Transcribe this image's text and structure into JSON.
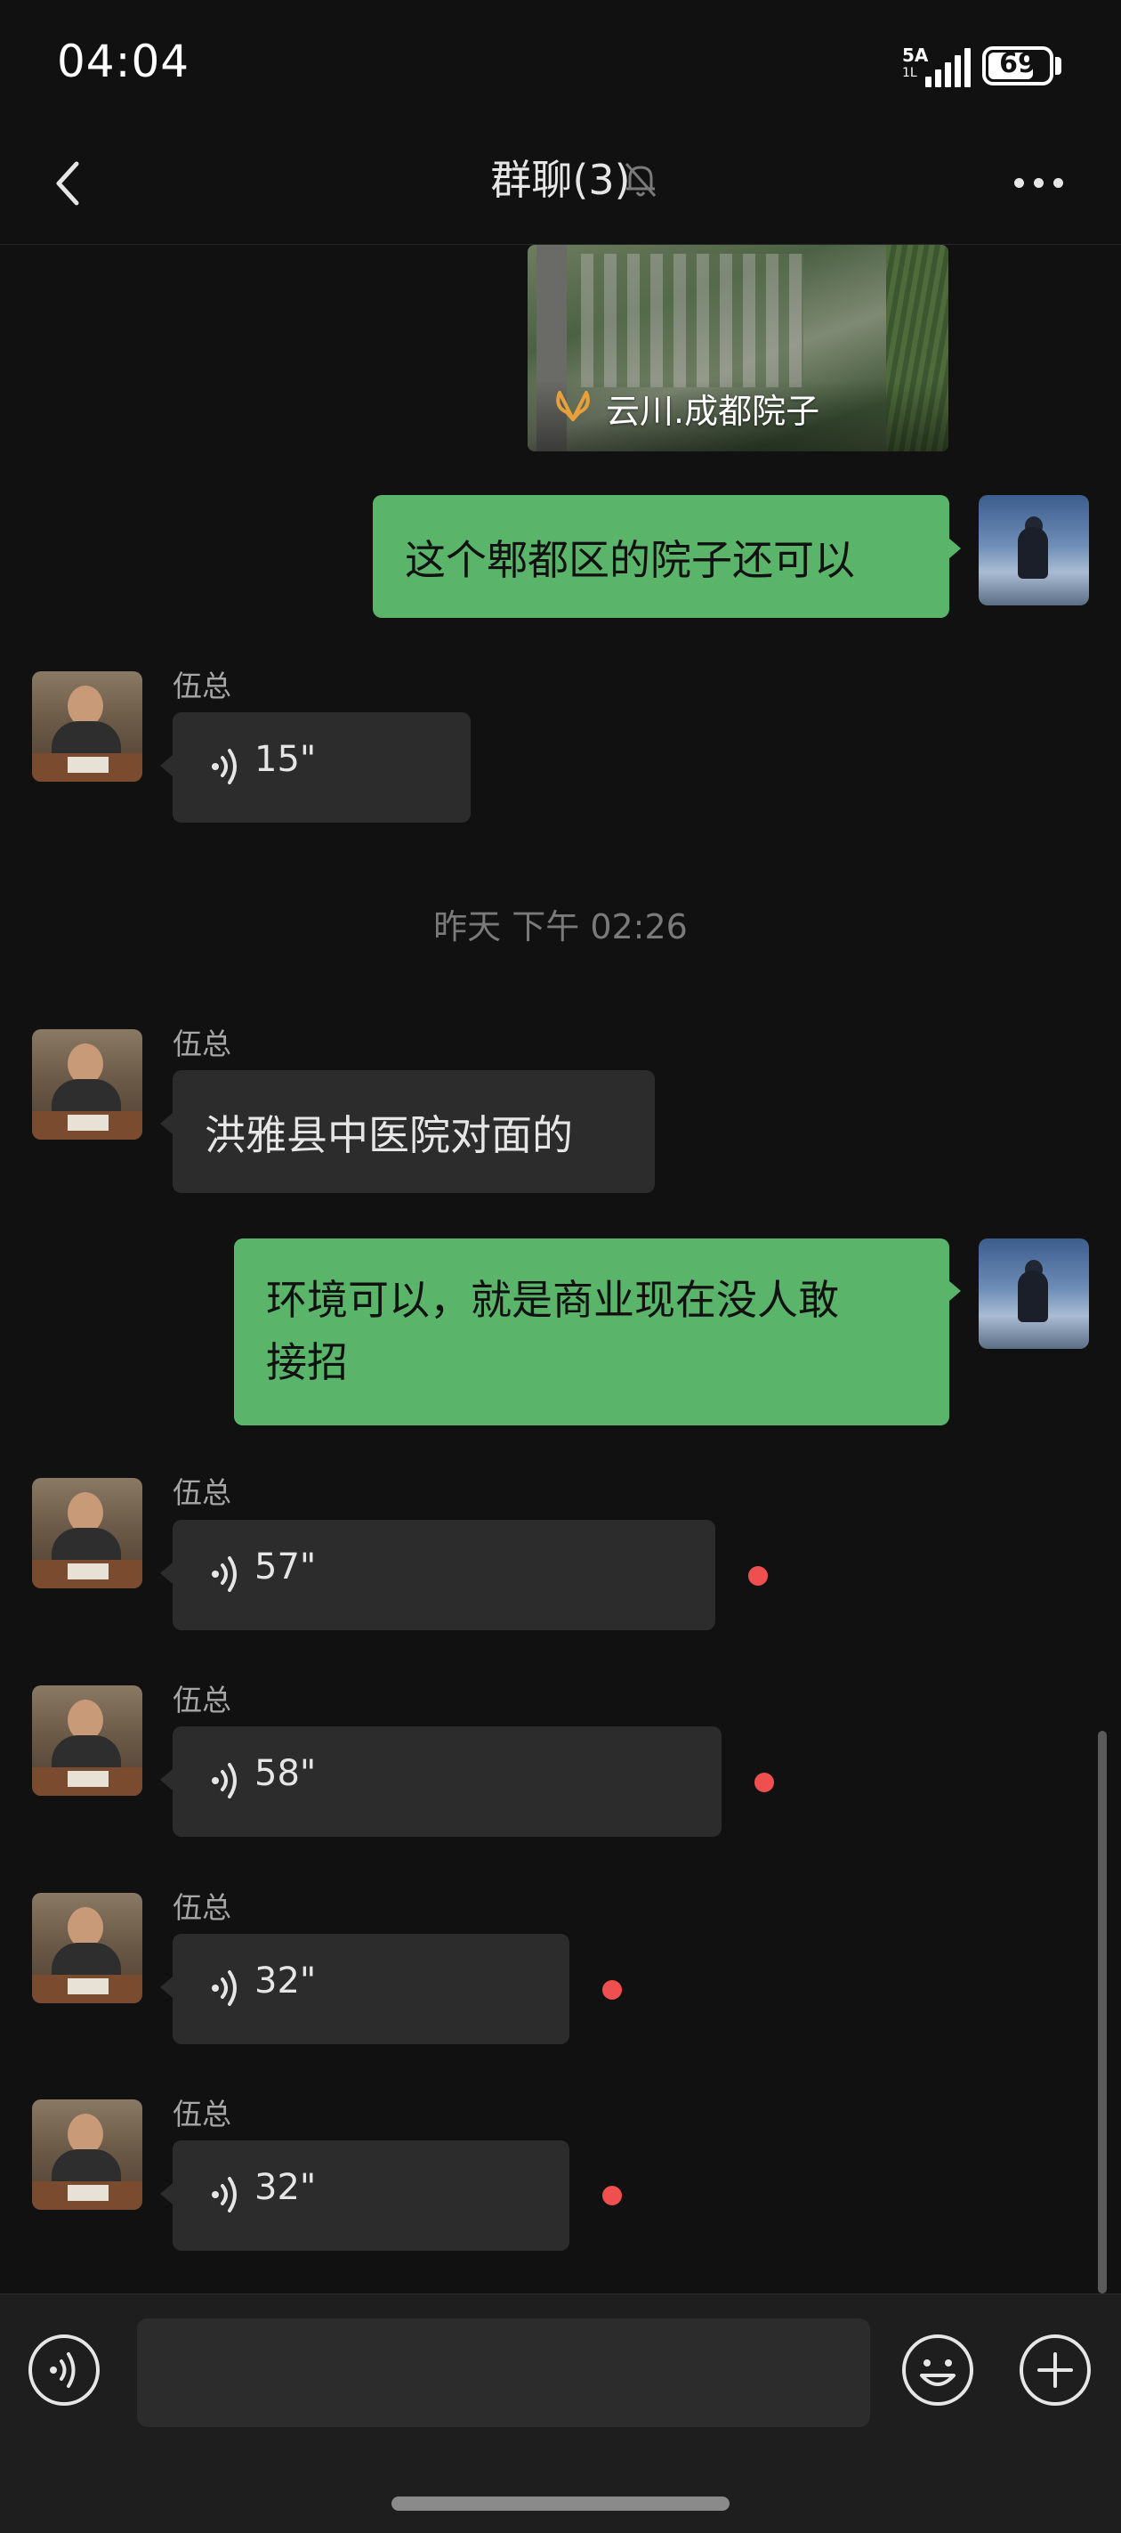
{
  "status_bar": {
    "time": "04:04",
    "network": "5A",
    "network_sub": "1L",
    "battery": "69"
  },
  "header": {
    "title": "群聊(3)",
    "icons": {
      "back": "chevron-left-icon",
      "mute": "bell-off-icon",
      "more": "more-dots-icon"
    }
  },
  "messages": [
    {
      "type": "image",
      "direction": "outgoing",
      "caption": "云川.成都院子"
    },
    {
      "type": "text",
      "direction": "outgoing",
      "text": "这个郫都区的院子还可以"
    },
    {
      "type": "voice",
      "direction": "incoming",
      "sender": "伍总",
      "duration": "15\"",
      "unread": false
    },
    {
      "type": "timestamp",
      "text": "昨天 下午 02:26"
    },
    {
      "type": "text",
      "direction": "incoming",
      "sender": "伍总",
      "text": "洪雅县中医院对面的"
    },
    {
      "type": "text",
      "direction": "outgoing",
      "text_lines": [
        "环境可以，就是商业现在没人敢",
        "接招"
      ]
    },
    {
      "type": "voice",
      "direction": "incoming",
      "sender": "伍总",
      "duration": "57\"",
      "unread": true
    },
    {
      "type": "voice",
      "direction": "incoming",
      "sender": "伍总",
      "duration": "58\"",
      "unread": true
    },
    {
      "type": "voice",
      "direction": "incoming",
      "sender": "伍总",
      "duration": "32\"",
      "unread": true
    },
    {
      "type": "voice",
      "direction": "incoming",
      "sender": "伍总",
      "duration": "32\"",
      "unread": true
    }
  ],
  "input_bar": {
    "value": "",
    "icons": {
      "voice": "voice-input-icon",
      "emoji": "emoji-icon",
      "plus": "plus-icon"
    }
  },
  "colors": {
    "background": "#111111",
    "outgoing_bubble": "#5ab56a",
    "incoming_bubble": "#2c2c2c",
    "unread_dot": "#f04f4f"
  }
}
